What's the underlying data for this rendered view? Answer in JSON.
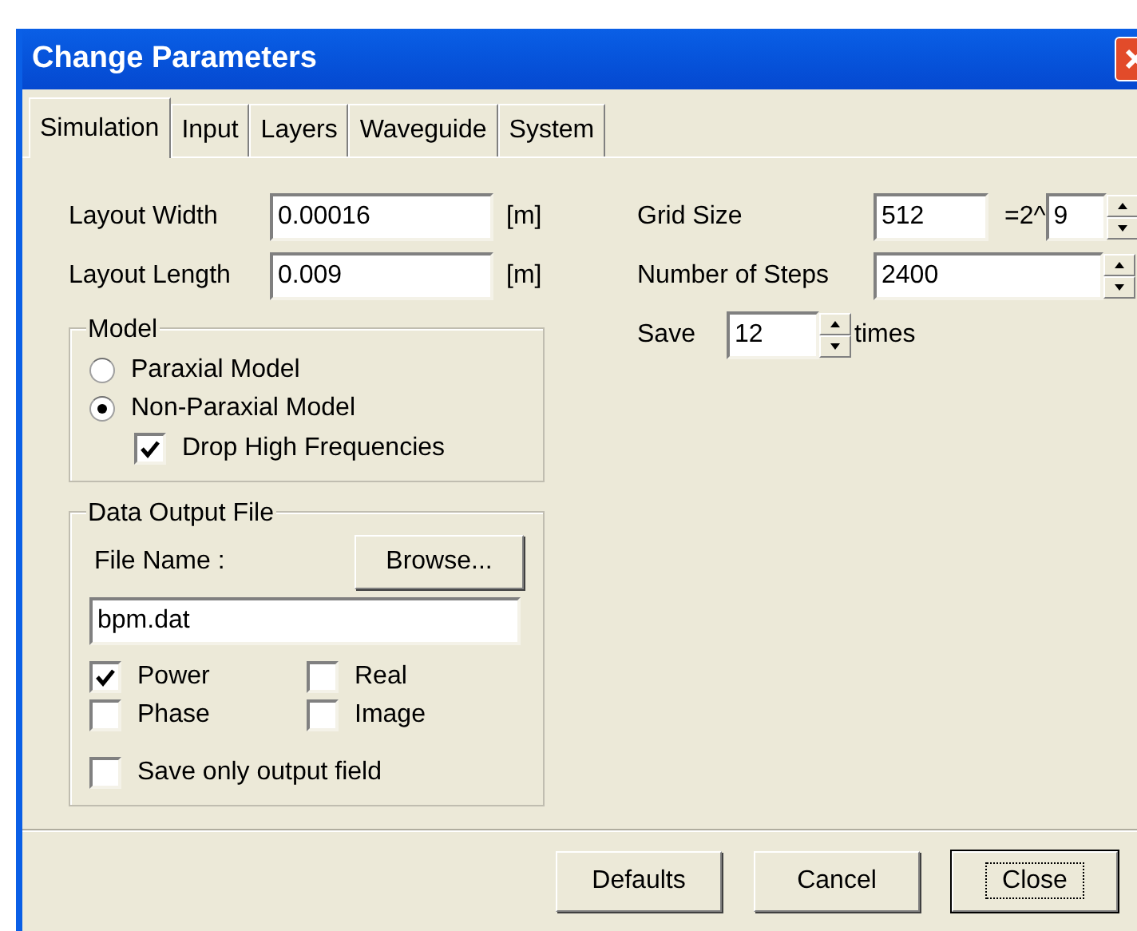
{
  "window": {
    "title": "Change Parameters"
  },
  "tabs": [
    {
      "label": "Simulation",
      "selected": true
    },
    {
      "label": "Input",
      "selected": false
    },
    {
      "label": "Layers",
      "selected": false
    },
    {
      "label": "Waveguide",
      "selected": false
    },
    {
      "label": "System",
      "selected": false
    }
  ],
  "layout": [
    {
      "label": "Layout Width",
      "value": "0.00016",
      "unit": "[m]"
    },
    {
      "label": "Layout Length",
      "value": "0.009",
      "unit": "[m]"
    }
  ],
  "model": {
    "title": "Model",
    "options": [
      {
        "label": "Paraxial Model",
        "selected": false
      },
      {
        "label": "Non-Paraxial Model",
        "selected": true
      }
    ],
    "drop_high_frequencies": {
      "label": "Drop High Frequencies",
      "checked": true
    }
  },
  "output": {
    "title": "Data Output File",
    "file_name_label": "File Name :",
    "browse": {
      "label": "Browse..."
    },
    "file_name": "bpm.dat",
    "options": [
      {
        "label": "Power",
        "checked": true
      },
      {
        "label": "Real",
        "checked": false
      },
      {
        "label": "Phase",
        "checked": false
      },
      {
        "label": "Image",
        "checked": false
      }
    ],
    "save_only": {
      "label": "Save only output field",
      "checked": false
    }
  },
  "grid": {
    "label": "Grid Size",
    "value": "512",
    "exp_label": "=2^",
    "exp_value": "9"
  },
  "steps": {
    "label": "Number of Steps",
    "value": "2400"
  },
  "save": {
    "label": "Save",
    "value": "12",
    "unit": "times"
  },
  "buttons": [
    {
      "label": "Defaults",
      "default": false
    },
    {
      "label": "Cancel",
      "default": false
    },
    {
      "label": "Close",
      "default": true
    }
  ]
}
